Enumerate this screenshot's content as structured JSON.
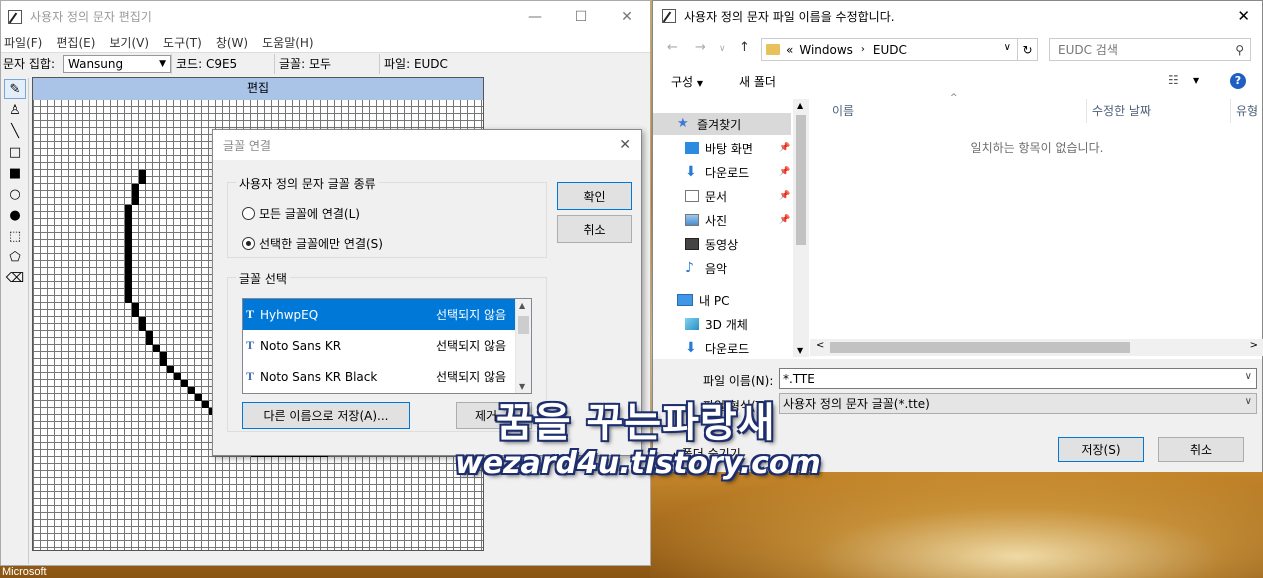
{
  "editor": {
    "title": "사용자 정의 문자 편집기",
    "menu": [
      "파일(F)",
      "편집(E)",
      "보기(V)",
      "도구(T)",
      "창(W)",
      "도움말(H)"
    ],
    "charset_label": "문자 집합:",
    "charset_value": "Wansung",
    "code": "코드: C9E5",
    "font": "글꼴: 모두",
    "file": "파일: EUDC",
    "grid_header": "편집"
  },
  "link_dialog": {
    "title": "글꼴 연결",
    "group1_title": "사용자 정의 문자 글꼴 종류",
    "radio_all": "모든 글꼴에 연결(L)",
    "radio_selected": "선택한 글꼴에만 연결(S)",
    "group2_title": "글꼴 선택",
    "ok": "확인",
    "cancel": "취소",
    "fonts": [
      {
        "name": "HyhwpEQ",
        "status": "선택되지 않음"
      },
      {
        "name": "Noto Sans KR",
        "status": "선택되지 않음"
      },
      {
        "name": "Noto Sans KR Black",
        "status": "선택되지 않음"
      }
    ],
    "save_as": "다른 이름으로 저장(A)...",
    "remove": "제거"
  },
  "save_dialog": {
    "title": "사용자 정의 문자 파일 이름을 수정합니다.",
    "breadcrumb_prefix": "«",
    "breadcrumb": [
      "Windows",
      "EUDC"
    ],
    "search_placeholder": "EUDC 검색",
    "organize": "구성",
    "new_folder": "새 폴더",
    "nav": {
      "quick_access": "즐겨찾기",
      "desktop": "바탕 화면",
      "downloads": "다운로드",
      "documents": "문서",
      "pictures": "사진",
      "videos": "동영상",
      "music": "음악",
      "this_pc": "내 PC",
      "objects_3d": "3D 개체",
      "downloads2": "다운로드"
    },
    "columns": {
      "name": "이름",
      "modified": "수정한 날짜",
      "type": "유형"
    },
    "empty_message": "일치하는 항목이 없습니다.",
    "filename_label": "파일 이름(N):",
    "filename_value": "*.TTE",
    "filetype_label": "파일 형식(T):",
    "filetype_value": "사용자 정의 문자 글꼴(*.tte)",
    "hide_folders": "폴더 숨기기",
    "save": "저장(S)",
    "cancel": "취소"
  },
  "taskbar_text": "Microsoft",
  "watermark": {
    "line1": "꿈을 꾸는파랑새",
    "line2": "wezard4u.tistory.com"
  }
}
